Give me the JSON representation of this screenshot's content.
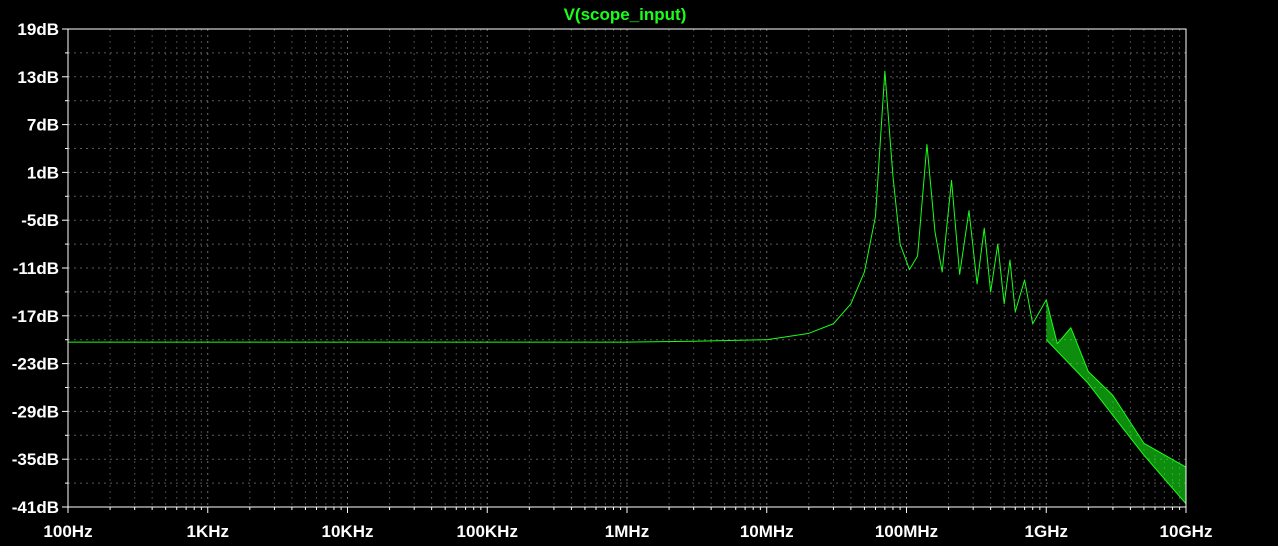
{
  "chart_data": {
    "type": "line",
    "title": "V(scope_input)",
    "xlabel": "",
    "ylabel": "",
    "x_scale": "log",
    "xlim": [
      "100Hz",
      "10GHz"
    ],
    "ylim": [
      -41,
      19
    ],
    "x_ticks": [
      "100Hz",
      "1KHz",
      "10KHz",
      "100KHz",
      "1MHz",
      "10MHz",
      "100MHz",
      "1GHz",
      "10GHz"
    ],
    "y_ticks": [
      "19dB",
      "13dB",
      "7dB",
      "1dB",
      "-5dB",
      "-11dB",
      "-17dB",
      "-23dB",
      "-29dB",
      "-35dB",
      "-41dB"
    ],
    "grid": true,
    "colors": {
      "background": "#000000",
      "trace": "#19ff19",
      "grid": "#7a7a7a",
      "frame": "#ffffff",
      "text": "#ffffff"
    },
    "series": [
      {
        "name": "V(scope_input)",
        "unit_x": "Hz",
        "unit_y": "dB",
        "points": [
          [
            100,
            -20.3
          ],
          [
            1000,
            -20.3
          ],
          [
            10000,
            -20.3
          ],
          [
            100000,
            -20.3
          ],
          [
            1000000,
            -20.3
          ],
          [
            3000000,
            -20.2
          ],
          [
            10000000,
            -20.0
          ],
          [
            20000000,
            -19.2
          ],
          [
            30000000,
            -18.0
          ],
          [
            40000000,
            -15.5
          ],
          [
            50000000,
            -11.5
          ],
          [
            60000000,
            -4.5
          ],
          [
            70000000,
            13.7
          ],
          [
            80000000,
            0.5
          ],
          [
            90000000,
            -8.0
          ],
          [
            105000000,
            -11.2
          ],
          [
            120000000,
            -9.5
          ],
          [
            140000000,
            4.5
          ],
          [
            160000000,
            -6.5
          ],
          [
            180000000,
            -11.5
          ],
          [
            210000000,
            0.0
          ],
          [
            240000000,
            -11.8
          ],
          [
            280000000,
            -3.8
          ],
          [
            320000000,
            -13.0
          ],
          [
            360000000,
            -6.0
          ],
          [
            400000000,
            -14.0
          ],
          [
            450000000,
            -8.0
          ],
          [
            500000000,
            -15.5
          ],
          [
            550000000,
            -10.0
          ],
          [
            600000000,
            -16.5
          ],
          [
            700000000,
            -12.5
          ],
          [
            800000000,
            -18.0
          ],
          [
            1000000000,
            -15.0
          ],
          [
            1200000000,
            -20.5
          ],
          [
            1500000000,
            -18.5
          ],
          [
            2000000000,
            -24.0
          ],
          [
            3000000000,
            -27.0
          ],
          [
            5000000000,
            -33.0
          ],
          [
            10000000000,
            -36.0
          ]
        ],
        "lower_envelope": [
          [
            1000000000,
            -20.0
          ],
          [
            2000000000,
            -25.5
          ],
          [
            3000000000,
            -29.5
          ],
          [
            5000000000,
            -34.5
          ],
          [
            10000000000,
            -40.6
          ]
        ]
      }
    ]
  }
}
